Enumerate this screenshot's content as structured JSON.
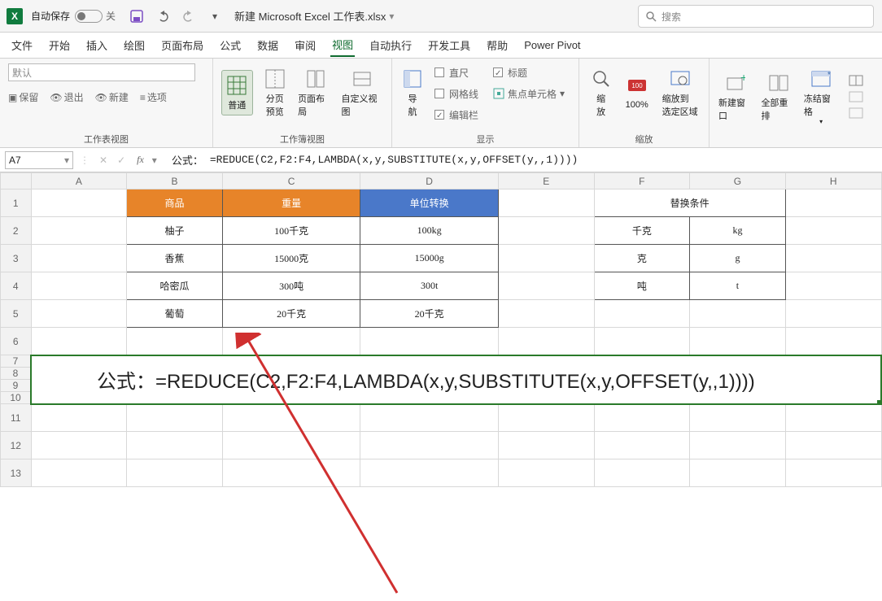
{
  "titlebar": {
    "autosave_label": "自动保存",
    "autosave_state": "关",
    "filename": "新建 Microsoft Excel 工作表.xlsx"
  },
  "search": {
    "placeholder": "搜索"
  },
  "tabs": [
    "文件",
    "开始",
    "插入",
    "绘图",
    "页面布局",
    "公式",
    "数据",
    "审阅",
    "视图",
    "自动执行",
    "开发工具",
    "帮助",
    "Power Pivot"
  ],
  "active_tab": "视图",
  "ribbon": {
    "wsview": {
      "label": "工作表视图",
      "dropdown": "默认",
      "keep": "保留",
      "exit": "退出",
      "new": "新建",
      "options": "选项"
    },
    "wbview": {
      "label": "工作簿视图",
      "normal": "普通",
      "page_break": "分页\n预览",
      "page_layout": "页面布局",
      "custom": "自定义视图"
    },
    "show": {
      "label": "显示",
      "nav": "导\n航",
      "ruler": "直尺",
      "grid": "网格线",
      "fbar": "编辑栏",
      "headings": "标题",
      "focus": "焦点单元格"
    },
    "zoom": {
      "label": "缩放",
      "zoom": "缩\n放",
      "p100": "100%",
      "fit": "缩放到\n选定区域"
    },
    "window": {
      "neww": "新建窗口",
      "arrange": "全部重排",
      "freeze": "冻结窗格"
    }
  },
  "namebox": "A7",
  "formula_prefix": "公式：",
  "formula": "=REDUCE(C2,F2:F4,LAMBDA(x,y,SUBSTITUTE(x,y,OFFSET(y,,1))))",
  "cols": [
    "A",
    "B",
    "C",
    "D",
    "E",
    "F",
    "G",
    "H"
  ],
  "rows": [
    "1",
    "2",
    "3",
    "4",
    "5",
    "6",
    "7",
    "8",
    "9",
    "10",
    "11",
    "12",
    "13"
  ],
  "table1": {
    "head": [
      "商品",
      "重量",
      "单位转换"
    ],
    "rows": [
      [
        "柚子",
        "100千克",
        "100kg"
      ],
      [
        "香蕉",
        "15000克",
        "15000g"
      ],
      [
        "哈密瓜",
        "300吨",
        "300t"
      ],
      [
        "葡萄",
        "20千克",
        "20千克"
      ]
    ]
  },
  "table2": {
    "title": "替换条件",
    "rows": [
      [
        "千克",
        "kg"
      ],
      [
        "克",
        "g"
      ],
      [
        "吨",
        "t"
      ]
    ]
  },
  "big_formula": "公式：=REDUCE(C2,F2:F4,LAMBDA(x,y,SUBSTITUTE(x,y,OFFSET(y,,1))))"
}
